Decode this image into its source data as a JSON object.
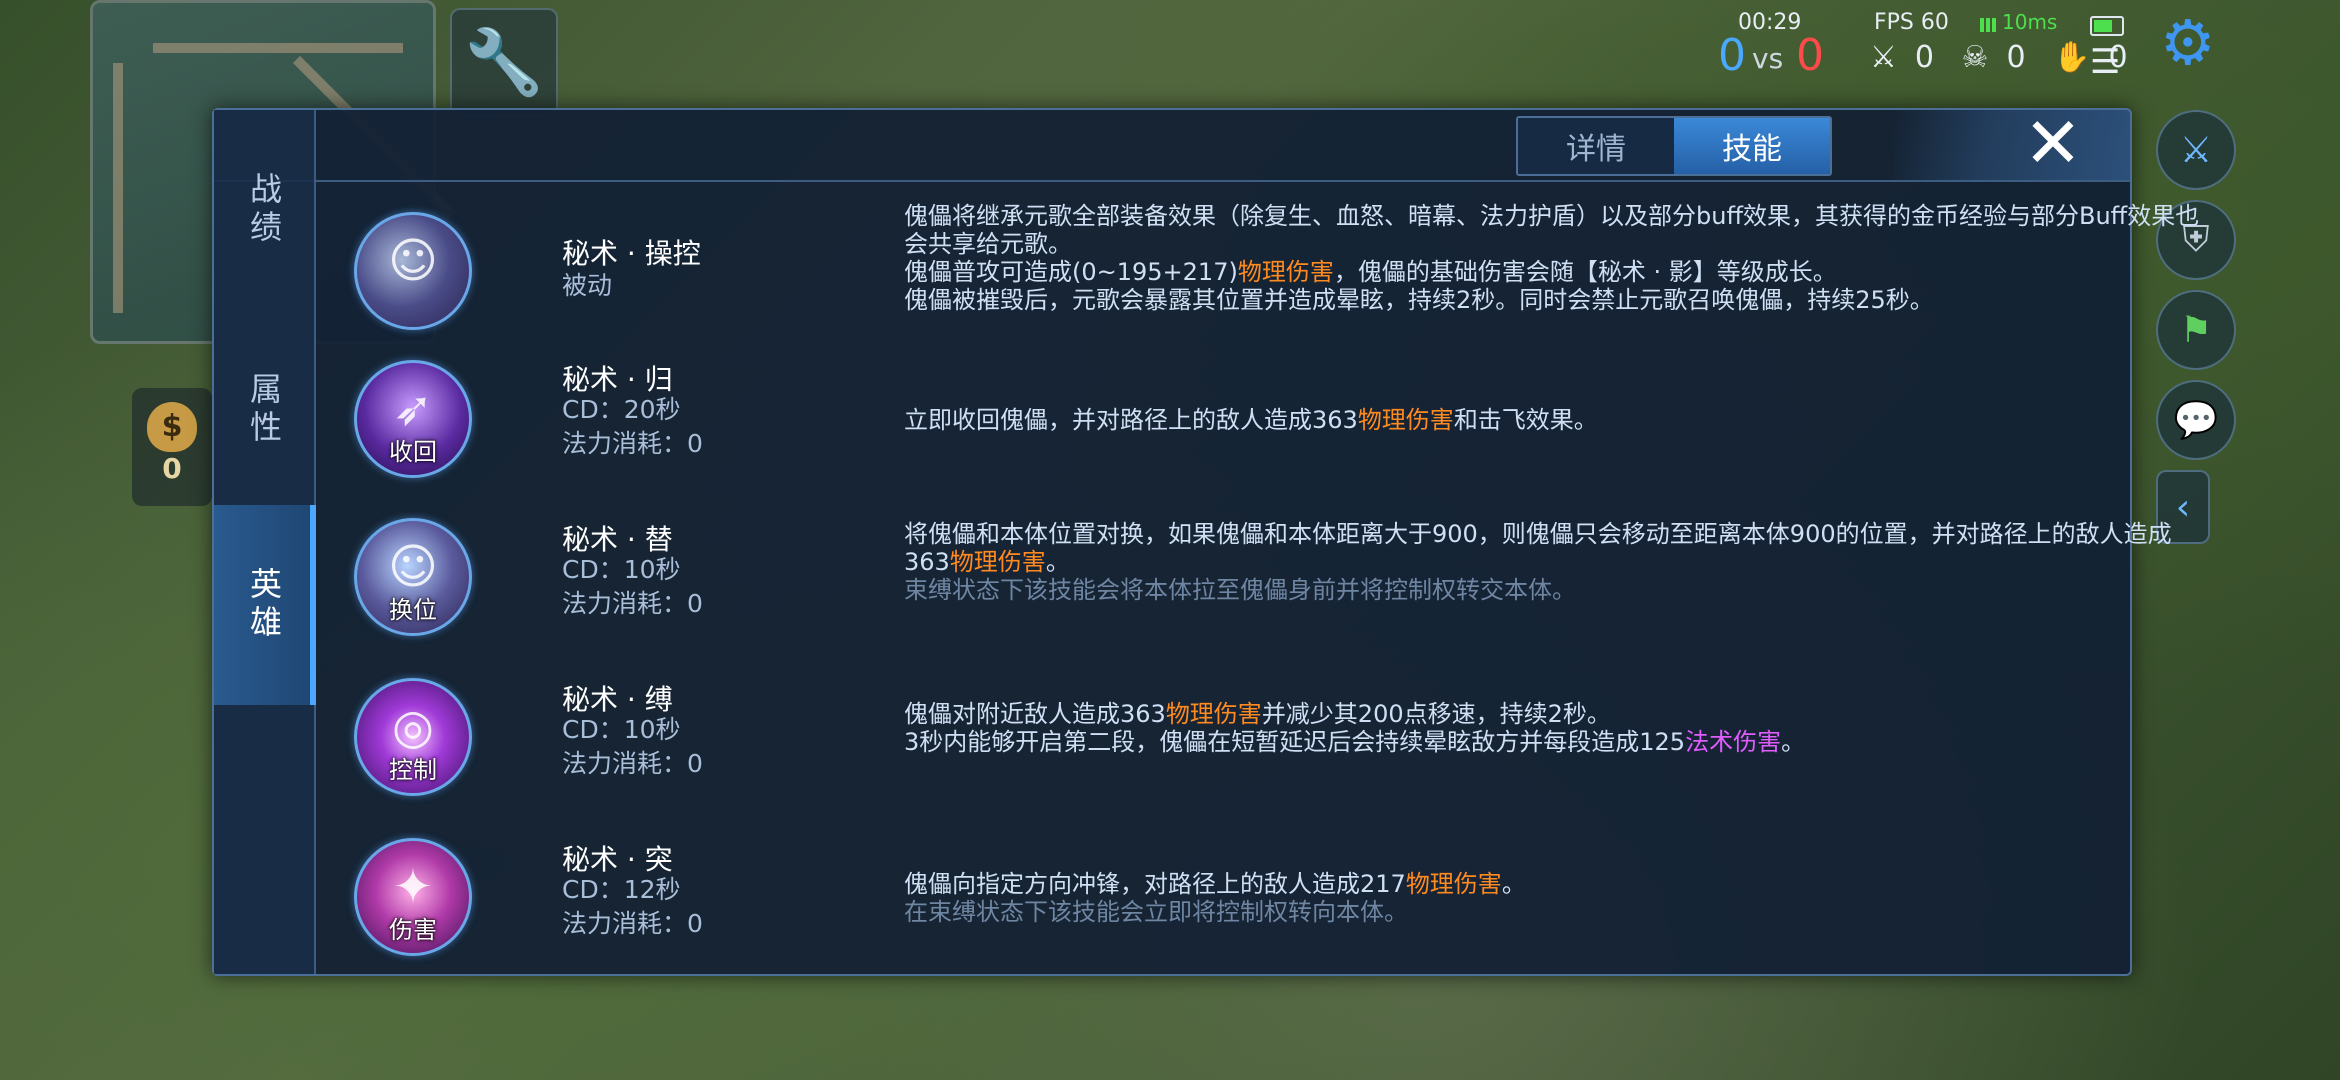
{
  "hud": {
    "time": "00:29",
    "fps": "FPS 60",
    "ping": "10ms",
    "score_blue": "0",
    "score_vs": "vs",
    "score_red": "0",
    "kills": "0",
    "deaths": "0",
    "assists": "0",
    "gold": "0",
    "gold_bag": "$"
  },
  "dialog": {
    "side_tabs": [
      "战绩",
      "属性",
      "英雄"
    ],
    "tabs": [
      "详情",
      "技能"
    ],
    "close": "✕"
  },
  "skills": [
    {
      "name": "秘术 · 操控",
      "type": "被动",
      "icon_label": "",
      "icon": "puppet-portrait-icon",
      "desc": [
        {
          "t": "傀儡将继承元歌全部装备效果（除复生、血怒、暗幕、法力护盾）以及部分buff效果，其获得的金币经验与部分Buff效果也会共享给元歌。"
        },
        {
          "t": "傀儡普攻可造成(0~195+217)"
        },
        {
          "t": "物理伤害",
          "c": "phys"
        },
        {
          "t": "，傀儡的基础伤害会随【秘术 · 影】等级成长。"
        },
        {
          "t": "傀儡被摧毁后，元歌会暴露其位置并造成晕眩，持续2秒。同时会禁止元歌召唤傀儡，持续25秒。"
        }
      ]
    },
    {
      "name": "秘术 · 归",
      "cd": "CD：20秒",
      "cost": "法力消耗：0",
      "icon_label": "收回",
      "icon": "recall-birds-icon",
      "desc": [
        {
          "t": "立即收回傀儡，并对路径上的敌人造成363"
        },
        {
          "t": "物理伤害",
          "c": "phys"
        },
        {
          "t": "和击飞效果。"
        }
      ]
    },
    {
      "name": "秘术 · 替",
      "cd": "CD：10秒",
      "cost": "法力消耗：0",
      "icon_label": "换位",
      "icon": "swap-portrait-icon",
      "desc": [
        {
          "t": "将傀儡和本体位置对换，如果傀儡和本体距离大于900，则傀儡只会移动至距离本体900的位置，并对路径上的敌人造成363"
        },
        {
          "t": "物理伤害",
          "c": "phys"
        },
        {
          "t": "。"
        },
        {
          "t": "束缚状态下该技能会将本体拉至傀儡身前并将控制权转交本体。",
          "c": "note"
        }
      ]
    },
    {
      "name": "秘术 · 缚",
      "cd": "CD：10秒",
      "cost": "法力消耗：0",
      "icon_label": "控制",
      "icon": "vortex-control-icon",
      "desc": [
        {
          "t": "傀儡对附近敌人造成363"
        },
        {
          "t": "物理伤害",
          "c": "phys"
        },
        {
          "t": "并减少其200点移速，持续2秒。"
        },
        {
          "t": "3秒内能够开启第二段，傀儡在短暂延迟后会持续晕眩敌方并每段造成125"
        },
        {
          "t": "法术伤害",
          "c": "magic"
        },
        {
          "t": "。"
        }
      ]
    },
    {
      "name": "秘术 · 突",
      "cd": "CD：12秒",
      "cost": "法力消耗：0",
      "icon_label": "伤害",
      "icon": "dash-strike-icon",
      "desc": [
        {
          "t": "傀儡向指定方向冲锋，对路径上的敌人造成217"
        },
        {
          "t": "物理伤害",
          "c": "phys"
        },
        {
          "t": "。"
        },
        {
          "t": "在束缚状态下该技能会立即将控制权转向本体。",
          "c": "note"
        }
      ]
    }
  ],
  "colors": {
    "phys": "#ff8a20",
    "magic": "#e05cff",
    "accent": "#3a88d8"
  }
}
